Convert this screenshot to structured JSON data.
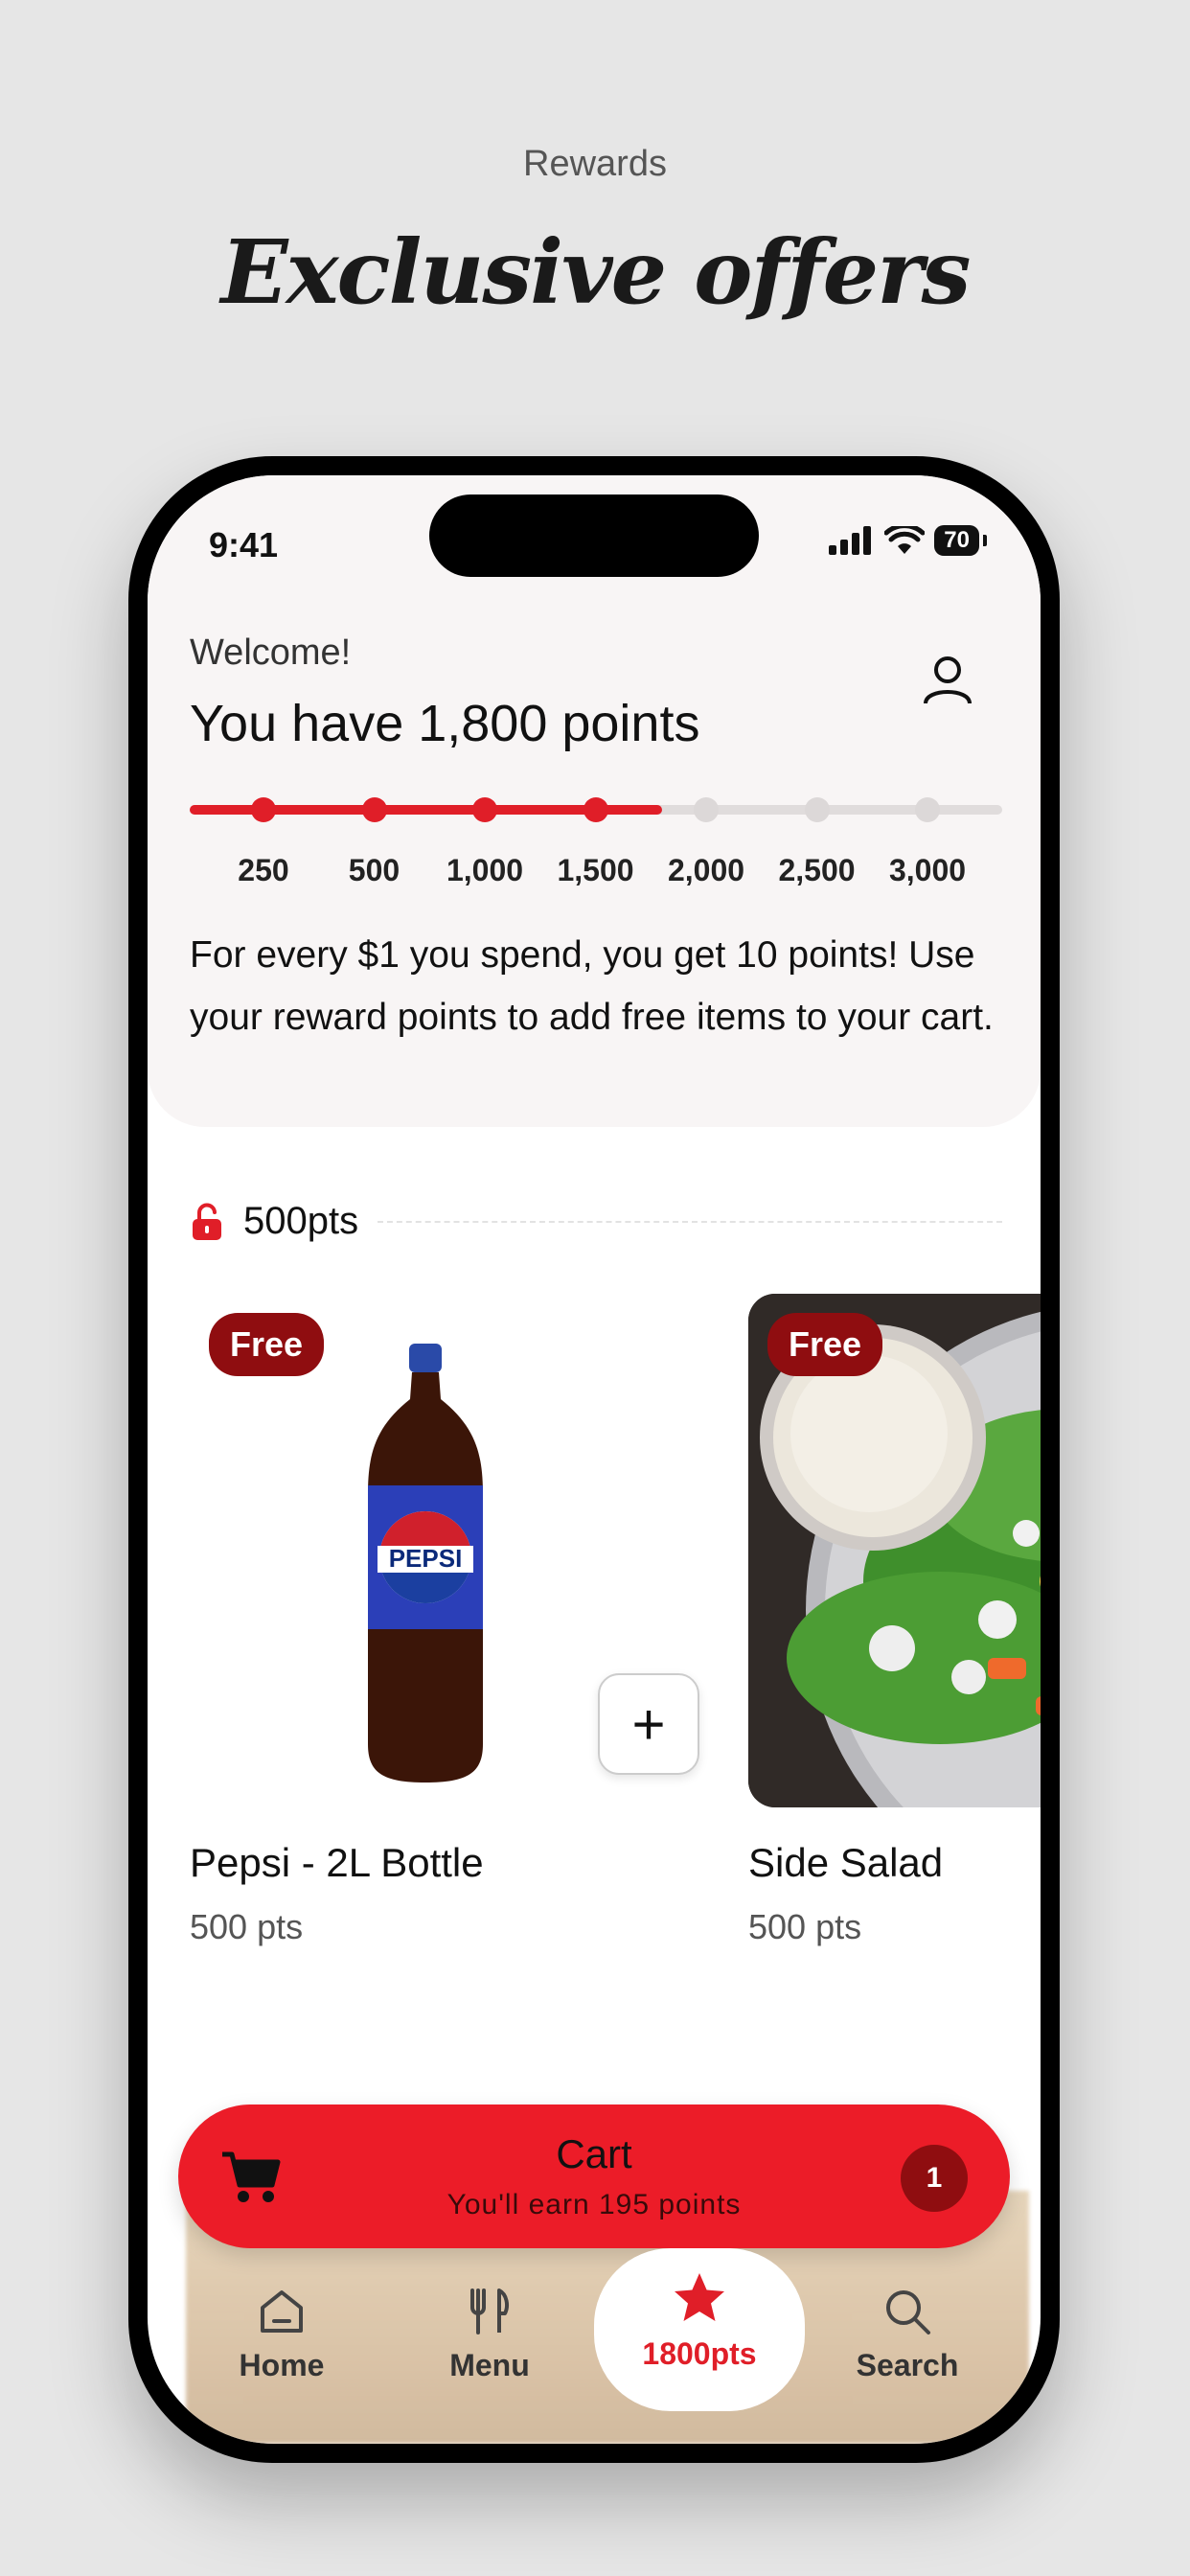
{
  "marketing": {
    "kicker": "Rewards",
    "headline": "Exclusive offers"
  },
  "status_bar": {
    "time": "9:41",
    "battery": "70"
  },
  "header": {
    "welcome": "Welcome!",
    "points_title": "You have 1,800 points",
    "description": "For every $1 you spend, you get 10 points! Use your reward points to add free items to your cart."
  },
  "progress": {
    "current_points": 1800,
    "ticks": [
      "250",
      "500",
      "1,000",
      "1,500",
      "2,000",
      "2,500",
      "3,000"
    ],
    "reached_count": 4
  },
  "section": {
    "label": "500pts"
  },
  "items": [
    {
      "badge": "Free",
      "title": "Pepsi - 2L Bottle",
      "pts": "500 pts",
      "add_label": "+",
      "image": "pepsi-bottle"
    },
    {
      "badge": "Free",
      "title": "Side Salad",
      "pts": "500 pts",
      "image": "side-salad"
    }
  ],
  "cart": {
    "title": "Cart",
    "subtitle": "You'll earn 195 points",
    "count": "1"
  },
  "tabs": [
    {
      "label": "Home",
      "icon": "home-icon"
    },
    {
      "label": "Menu",
      "icon": "utensils-icon"
    },
    {
      "label": "1800pts",
      "icon": "star-icon",
      "active": true
    },
    {
      "label": "Search",
      "icon": "search-icon"
    }
  ],
  "colors": {
    "accent": "#e01e28",
    "badge": "#8f0d10",
    "header_bg": "#f8f5f5"
  }
}
